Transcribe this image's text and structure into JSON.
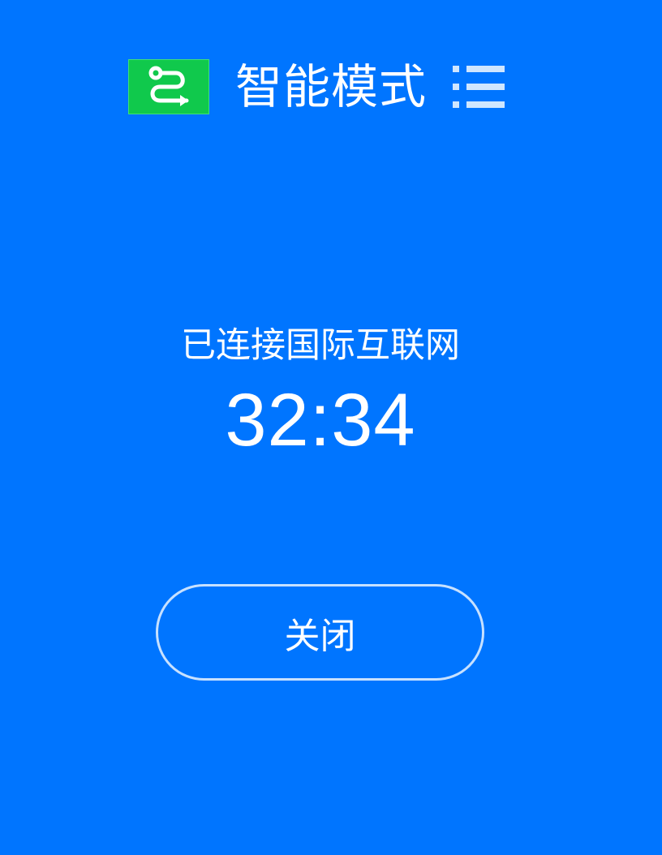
{
  "header": {
    "mode_icon": "route-icon",
    "title": "智能模式",
    "menu_icon": "menu-icon"
  },
  "connection": {
    "status_text": "已连接国际互联网",
    "elapsed_time": "32:34"
  },
  "actions": {
    "close_label": "关闭"
  },
  "colors": {
    "background": "#0075ff",
    "mode_icon_bg": "#10c94c",
    "text": "#ffffff"
  }
}
